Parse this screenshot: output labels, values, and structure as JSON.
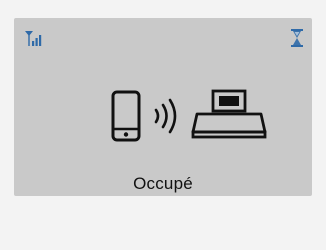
{
  "status": {
    "text": "Occupé"
  },
  "icons": {
    "signal": "signal-strength-icon",
    "busy": "hourglass-icon",
    "phone": "smartphone-icon",
    "waves": "wireless-waves-icon",
    "printer": "photo-printer-icon"
  },
  "colors": {
    "page_background": "#f3f3f3",
    "screen_background": "#c9c9c9",
    "signal_icon": "#2f6aa8",
    "hourglass_icon": "#2f6aa8",
    "glyphs": "#111111"
  }
}
